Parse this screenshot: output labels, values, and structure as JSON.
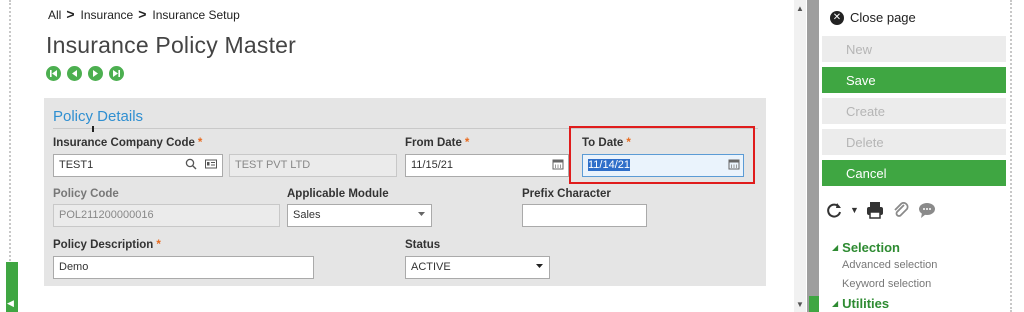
{
  "breadcrumb": {
    "items": [
      "All",
      "Insurance",
      "Insurance Setup"
    ],
    "separator": ">"
  },
  "page": {
    "title": "Insurance Policy Master"
  },
  "nav": {
    "buttons": [
      "first-icon",
      "previous-icon",
      "next-icon",
      "last-icon"
    ],
    "color": "#4caf50"
  },
  "panel": {
    "title": "Policy Details",
    "fields": {
      "insurance_company_code": {
        "label": "Insurance Company Code",
        "value": "TEST1",
        "name_value": "TEST PVT LTD"
      },
      "from_date": {
        "label": "From Date",
        "value": "11/15/21"
      },
      "to_date": {
        "label": "To Date",
        "value": "11/14/21"
      },
      "policy_code": {
        "label": "Policy Code",
        "value": "POL211200000016"
      },
      "applicable_module": {
        "label": "Applicable Module",
        "value": "Sales"
      },
      "prefix_character": {
        "label": "Prefix Character",
        "value": ""
      },
      "policy_description": {
        "label": "Policy Description",
        "value": "Demo"
      },
      "status": {
        "label": "Status",
        "value": "ACTIVE"
      }
    },
    "required_marker": "*"
  },
  "sidebar": {
    "close_label": "Close page",
    "actions": [
      {
        "label": "New",
        "enabled": false
      },
      {
        "label": "Save",
        "enabled": true
      },
      {
        "label": "Create",
        "enabled": false
      },
      {
        "label": "Delete",
        "enabled": false
      },
      {
        "label": "Cancel",
        "enabled": true
      }
    ],
    "tools": [
      "refresh-icon",
      "print-icon",
      "attachment-icon",
      "comment-icon"
    ],
    "sections": [
      {
        "title": "Selection",
        "items": [
          "Advanced selection",
          "Keyword selection"
        ]
      },
      {
        "title": "Utilities",
        "items": []
      }
    ]
  },
  "colors": {
    "accent_green": "#3fa642",
    "title_blue": "#2f8fd1",
    "required_orange": "#e86b1f",
    "highlight_red": "#e01c1c"
  }
}
